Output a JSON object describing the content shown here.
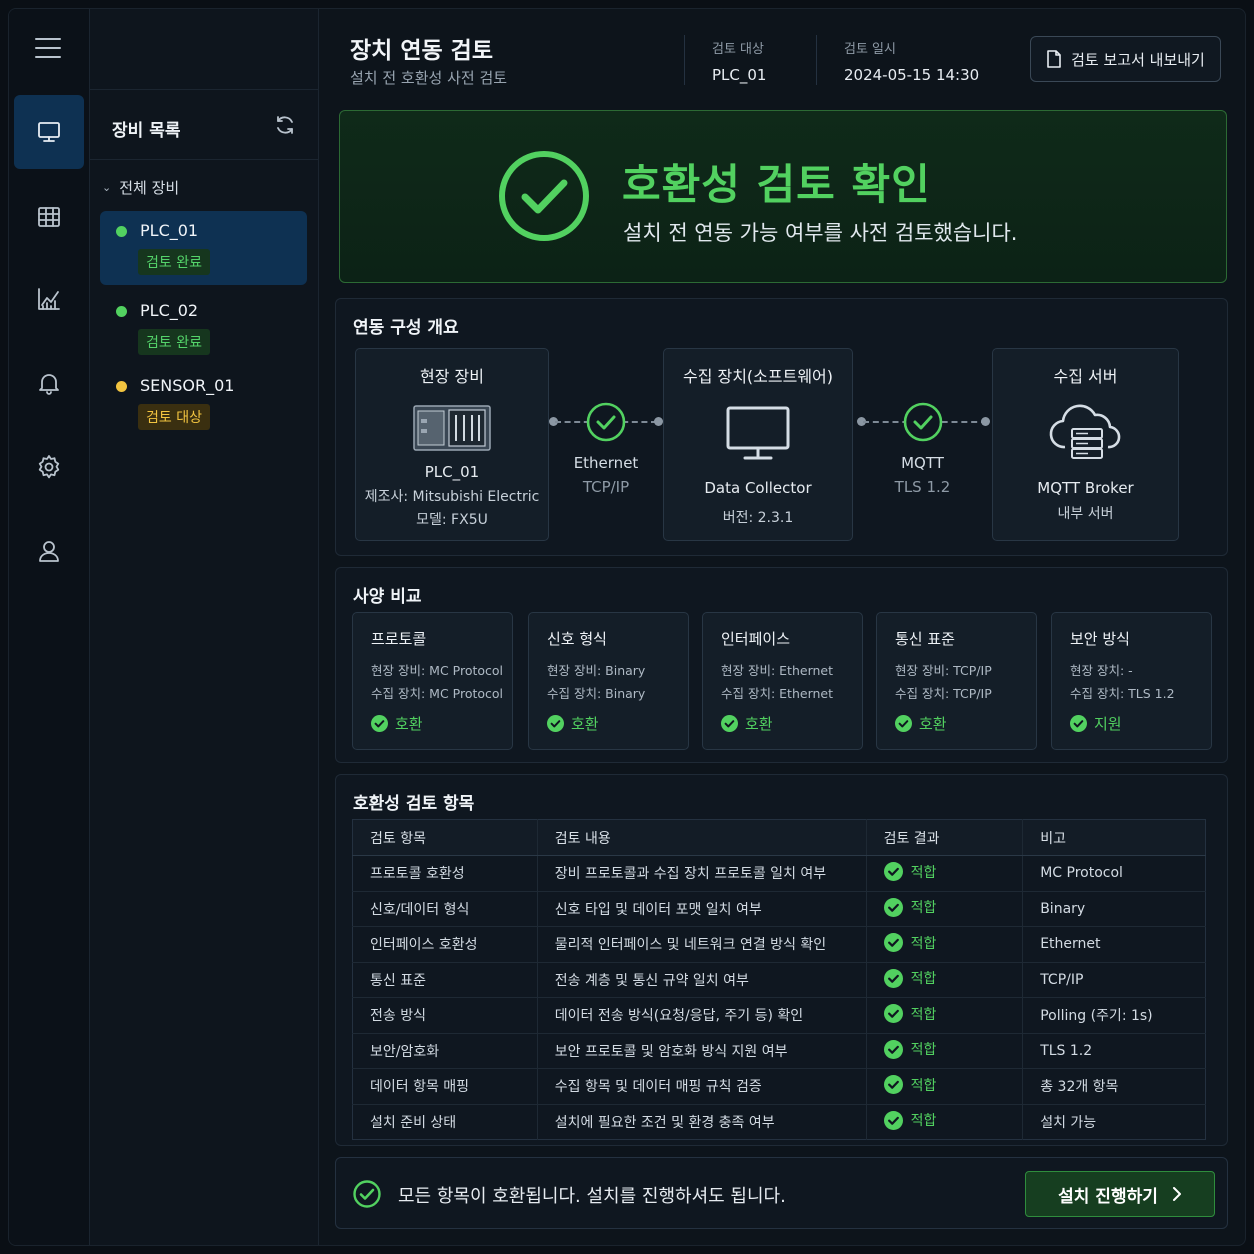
{
  "sidebar": {
    "menu_icon": "hamburger-menu-icon",
    "items": [
      {
        "icon": "monitor-icon",
        "active": true
      },
      {
        "icon": "grid-table-icon",
        "active": false
      },
      {
        "icon": "line-chart-icon",
        "active": false
      },
      {
        "icon": "bell-icon",
        "active": false
      },
      {
        "icon": "gear-icon",
        "active": false
      },
      {
        "icon": "user-icon",
        "active": false
      }
    ]
  },
  "devices": {
    "title": "장비 목록",
    "refresh_icon": "refresh-icon",
    "group_label": "전체 장비",
    "items": [
      {
        "name": "PLC_01",
        "status": "검토 완료",
        "state": "ok",
        "selected": true
      },
      {
        "name": "PLC_02",
        "status": "검토 완료",
        "state": "ok",
        "selected": false
      },
      {
        "name": "SENSOR_01",
        "status": "검토 대상",
        "state": "pending",
        "selected": false
      }
    ]
  },
  "header": {
    "title": "장치 연동 검토",
    "subtitle": "설치 전 호환성 사전 검토",
    "target_label": "검토 대상",
    "target_value": "PLC_01",
    "date_label": "검토 일시",
    "date_value": "2024-05-15 14:30",
    "export_label": "검토 보고서 내보내기"
  },
  "banner": {
    "title": "호환성 검토 확인",
    "subtitle": "설치 전 연동 가능 여부를 사전 검토했습니다."
  },
  "topology": {
    "title": "연동 구성 개요",
    "field": {
      "title": "현장 장비",
      "name": "PLC_01",
      "maker": "제조사: Mitsubishi Electric",
      "model": "모델: FX5U"
    },
    "link1": {
      "l1": "Ethernet",
      "l2": "TCP/IP"
    },
    "collector": {
      "title": "수집 장치(소프트웨어)",
      "name": "Data Collector",
      "version": "버전: 2.3.1"
    },
    "link2": {
      "l1": "MQTT",
      "l2": "TLS 1.2"
    },
    "server": {
      "title": "수집 서버",
      "name": "MQTT Broker",
      "desc": "내부 서버"
    }
  },
  "specs": {
    "title": "사양 비교",
    "items": [
      {
        "title": "프로토콜",
        "field": "현장 장비:  MC Protocol",
        "collector": "수집 장치:  MC Protocol",
        "result": "호환"
      },
      {
        "title": "신호 형식",
        "field": "현장 장비:  Binary",
        "collector": "수집 장치:  Binary",
        "result": "호환"
      },
      {
        "title": "인터페이스",
        "field": "현장 장비:  Ethernet",
        "collector": "수집 장치:  Ethernet",
        "result": "호환"
      },
      {
        "title": "통신 표준",
        "field": "현장 장비:  TCP/IP",
        "collector": "수집 장치:  TCP/IP",
        "result": "호환"
      },
      {
        "title": "보안 방식",
        "field": "현장 장치:  -",
        "collector": "수집 장치:  TLS 1.2",
        "result": "지원"
      }
    ]
  },
  "checks": {
    "title": "호환성 검토 항목",
    "columns": [
      "검토 항목",
      "검토 내용",
      "검토 결과",
      "비고"
    ],
    "rows": [
      {
        "item": "프로토콜 호환성",
        "desc": "장비 프로토콜과 수집 장치 프로토콜 일치 여부",
        "result": "적합",
        "note": "MC Protocol"
      },
      {
        "item": "신호/데이터 형식",
        "desc": "신호 타입 및 데이터 포맷 일치 여부",
        "result": "적합",
        "note": "Binary"
      },
      {
        "item": "인터페이스 호환성",
        "desc": "물리적 인터페이스 및 네트워크 연결 방식 확인",
        "result": "적합",
        "note": "Ethernet"
      },
      {
        "item": "통신 표준",
        "desc": "전송 계층 및 통신 규약 일치 여부",
        "result": "적합",
        "note": "TCP/IP"
      },
      {
        "item": "전송 방식",
        "desc": "데이터 전송 방식(요청/응답, 주기 등) 확인",
        "result": "적합",
        "note": "Polling (주기: 1s)"
      },
      {
        "item": "보안/암호화",
        "desc": "보안 프로토콜 및 암호화 방식 지원 여부",
        "result": "적합",
        "note": "TLS 1.2"
      },
      {
        "item": "데이터 항목 매핑",
        "desc": "수집 항목 및 데이터 매핑 규칙 검증",
        "result": "적합",
        "note": "총 32개 항목"
      },
      {
        "item": "설치 준비 상태",
        "desc": "설치에 필요한 조건 및 환경 충족 여부",
        "result": "적합",
        "note": "설치 가능"
      }
    ]
  },
  "footer": {
    "message": "모든 항목이 호환됩니다. 설치를 진행하셔도 됩니다.",
    "proceed_label": "설치 진행하기"
  },
  "colors": {
    "accent_green": "#52d160",
    "selected_blue": "#0e3152",
    "pending_yellow": "#f2c440",
    "background": "#0d141b"
  }
}
